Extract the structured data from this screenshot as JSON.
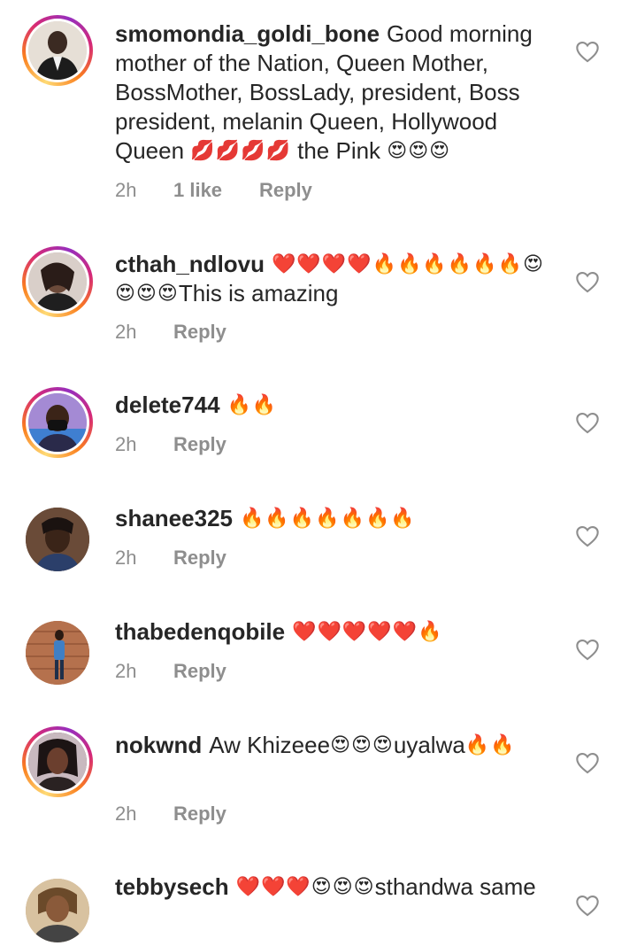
{
  "comments": [
    {
      "username": "smomondia_goldi_bone",
      "text": "Good morning mother of the Nation, Queen Mother, BossMother, BossLady, president, Boss president, melanin Queen, Hollywood Queen",
      "emoji_a": "💋💋💋💋",
      "text_b": " the Pink ",
      "emoji_b": "😍😍😍",
      "text_c": "",
      "time": "2h",
      "likes": "1 like",
      "reply": "Reply",
      "story_ring": true
    },
    {
      "username": "cthah_ndlovu",
      "text": "",
      "emoji_a": "❤️❤️❤️❤️🔥🔥🔥🔥🔥🔥😍😍😍😍",
      "text_b": "This is amazing",
      "emoji_b": "",
      "text_c": "",
      "time": "2h",
      "likes": "",
      "reply": "Reply",
      "story_ring": true
    },
    {
      "username": "delete744",
      "text": "",
      "emoji_a": "🔥🔥",
      "text_b": "",
      "emoji_b": "",
      "text_c": "",
      "time": "2h",
      "likes": "",
      "reply": "Reply",
      "story_ring": true
    },
    {
      "username": "shanee325",
      "text": "",
      "emoji_a": "🔥🔥🔥🔥🔥🔥🔥",
      "text_b": "",
      "emoji_b": "",
      "text_c": "",
      "time": "2h",
      "likes": "",
      "reply": "Reply",
      "story_ring": false
    },
    {
      "username": "thabedenqobile",
      "text": "",
      "emoji_a": "❤️❤️❤️❤️❤️🔥",
      "text_b": "",
      "emoji_b": "",
      "text_c": "",
      "time": "2h",
      "likes": "",
      "reply": "Reply",
      "story_ring": false
    },
    {
      "username": "nokwnd",
      "text": "Aw Khizeee",
      "emoji_a": "😍😍😍",
      "text_b": "uyalwa",
      "emoji_b": "🔥🔥",
      "text_c": "",
      "time": "2h",
      "likes": "",
      "reply": "Reply",
      "story_ring": true
    },
    {
      "username": "tebbysech",
      "text": "",
      "emoji_a": "❤️❤️❤️😍😍😍",
      "text_b": "sthandwa same",
      "emoji_b": "",
      "text_c": "",
      "time": "",
      "likes": "",
      "reply": "",
      "story_ring": false
    }
  ],
  "icons": {
    "like": "heart-outline-icon"
  },
  "colors": {
    "username": "#262626",
    "meta": "#8e8e8e",
    "story_ring": [
      "#feda75",
      "#fa7e1e",
      "#d62976",
      "#962fbf"
    ]
  }
}
